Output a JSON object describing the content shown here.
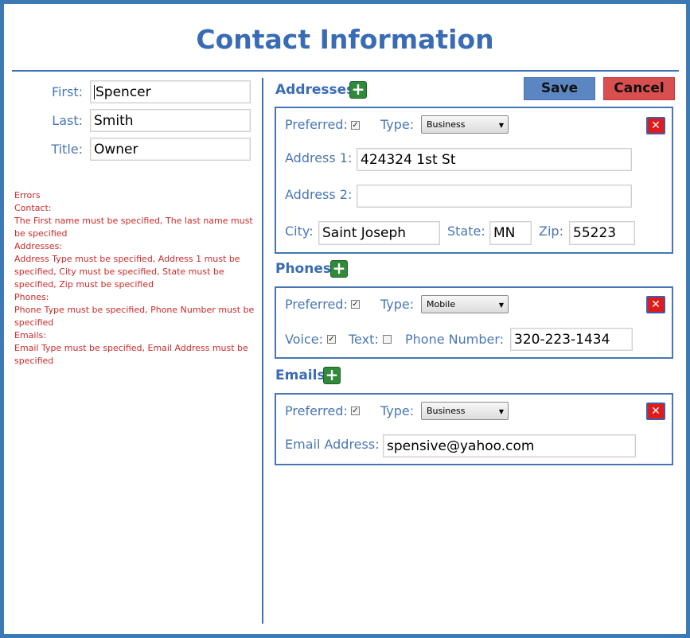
{
  "title": "Contact Information",
  "contact": {
    "first_label": "First:",
    "first_value": "Spencer",
    "last_label": "Last:",
    "last_value": "Smith",
    "title_label": "Title:",
    "title_value": "Owner"
  },
  "errors": {
    "lines": [
      "Errors",
      "Contact:",
      "The First name must be specified, The last name must be specified",
      "Addresses:",
      "Address Type must be specified, Address 1 must be specified, City must be specified, State must be specified, Zip must be specified",
      "Phones:",
      "Phone Type must be specified, Phone Number must be specified",
      "Emails:",
      "Email Type must be specified, Email Address must be specified"
    ]
  },
  "toolbar": {
    "save_label": "Save",
    "cancel_label": "Cancel"
  },
  "addresses": {
    "header": "Addresses",
    "add_icon": "plus-icon",
    "preferred_label": "Preferred:",
    "preferred_checked": true,
    "type_label": "Type:",
    "type_value": "Business",
    "address1_label": "Address 1:",
    "address1_value": "424324 1st St",
    "address2_label": "Address 2:",
    "address2_value": "",
    "city_label": "City:",
    "city_value": "Saint Joseph",
    "state_label": "State:",
    "state_value": "MN",
    "zip_label": "Zip:",
    "zip_value": "55223",
    "remove_icon": "close-icon"
  },
  "phones": {
    "header": "Phones",
    "add_icon": "plus-icon",
    "preferred_label": "Preferred:",
    "preferred_checked": true,
    "type_label": "Type:",
    "type_value": "Mobile",
    "voice_label": "Voice:",
    "voice_checked": true,
    "text_label": "Text:",
    "text_checked": false,
    "number_label": "Phone Number:",
    "number_value": "320-223-1434",
    "remove_icon": "close-icon"
  },
  "emails": {
    "header": "Emails",
    "add_icon": "plus-icon",
    "preferred_label": "Preferred:",
    "preferred_checked": true,
    "type_label": "Type:",
    "type_value": "Business",
    "address_label": "Email Address:",
    "address_value": "spensive@yahoo.com",
    "remove_icon": "close-icon"
  },
  "colors": {
    "accent": "#3a6bb5",
    "border": "#3d79b3",
    "error": "#cc2a2a",
    "add_green": "#2f8a3a",
    "remove_red": "#e11b1b",
    "save_bg": "#5b86c2",
    "cancel_bg": "#d94f4f"
  }
}
